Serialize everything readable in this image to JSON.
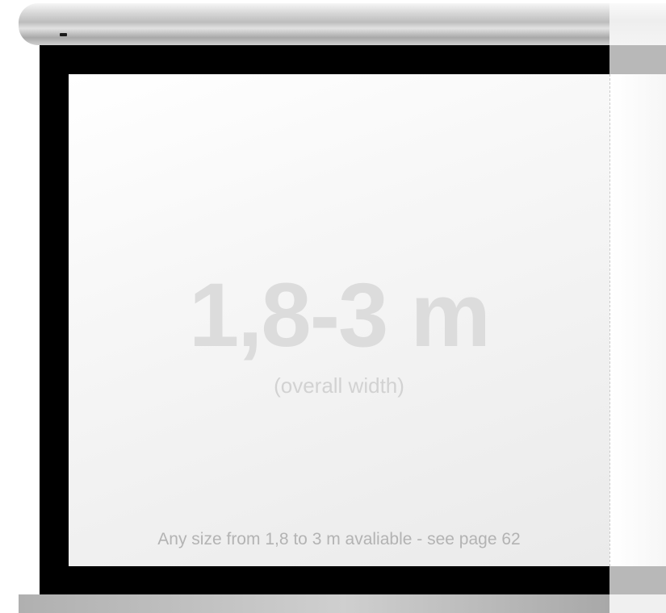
{
  "screen": {
    "size_range": "1,8-3 m",
    "size_caption": "(overall width)",
    "availability_note": "Any size from 1,8 to 3 m avaliable - see page 62"
  },
  "colors": {
    "frame": "#000000",
    "housing": "#c8c8c8",
    "screen_surface": "#f4f4f4",
    "text": "#dcdcdc"
  }
}
